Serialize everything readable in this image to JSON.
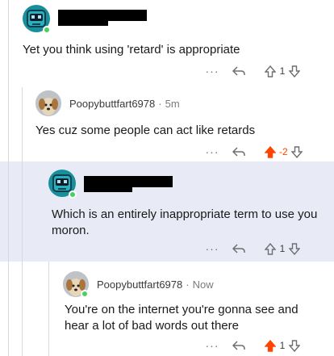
{
  "comments": [
    {
      "username": "",
      "time": "",
      "text": "Yet you think using 'retard' is appropriate",
      "score": "1",
      "upvoted": false,
      "avatar": "snoo-robot-avatar"
    },
    {
      "username": "Poopybuttfart6978",
      "time": "5m",
      "text": "Yes cuz some people can act like retards",
      "score": "-2",
      "upvoted": true,
      "avatar": "dog-avatar"
    },
    {
      "username": "",
      "time": "",
      "text": "Which is an entirely inappropriate term to use you moron.",
      "score": "1",
      "upvoted": false,
      "avatar": "snoo-robot-avatar"
    },
    {
      "username": "Poopybuttfart6978",
      "time": "Now",
      "text": "You're on the internet you're gonna see and hear a lot of bad words out there",
      "score": "1",
      "upvoted": true,
      "avatar": "dog-avatar"
    }
  ],
  "separator": "·",
  "more_label": "···",
  "colors": {
    "upvote_active": "#ff4500",
    "highlight_bg": "#e8ebf5",
    "online": "#46d160"
  }
}
